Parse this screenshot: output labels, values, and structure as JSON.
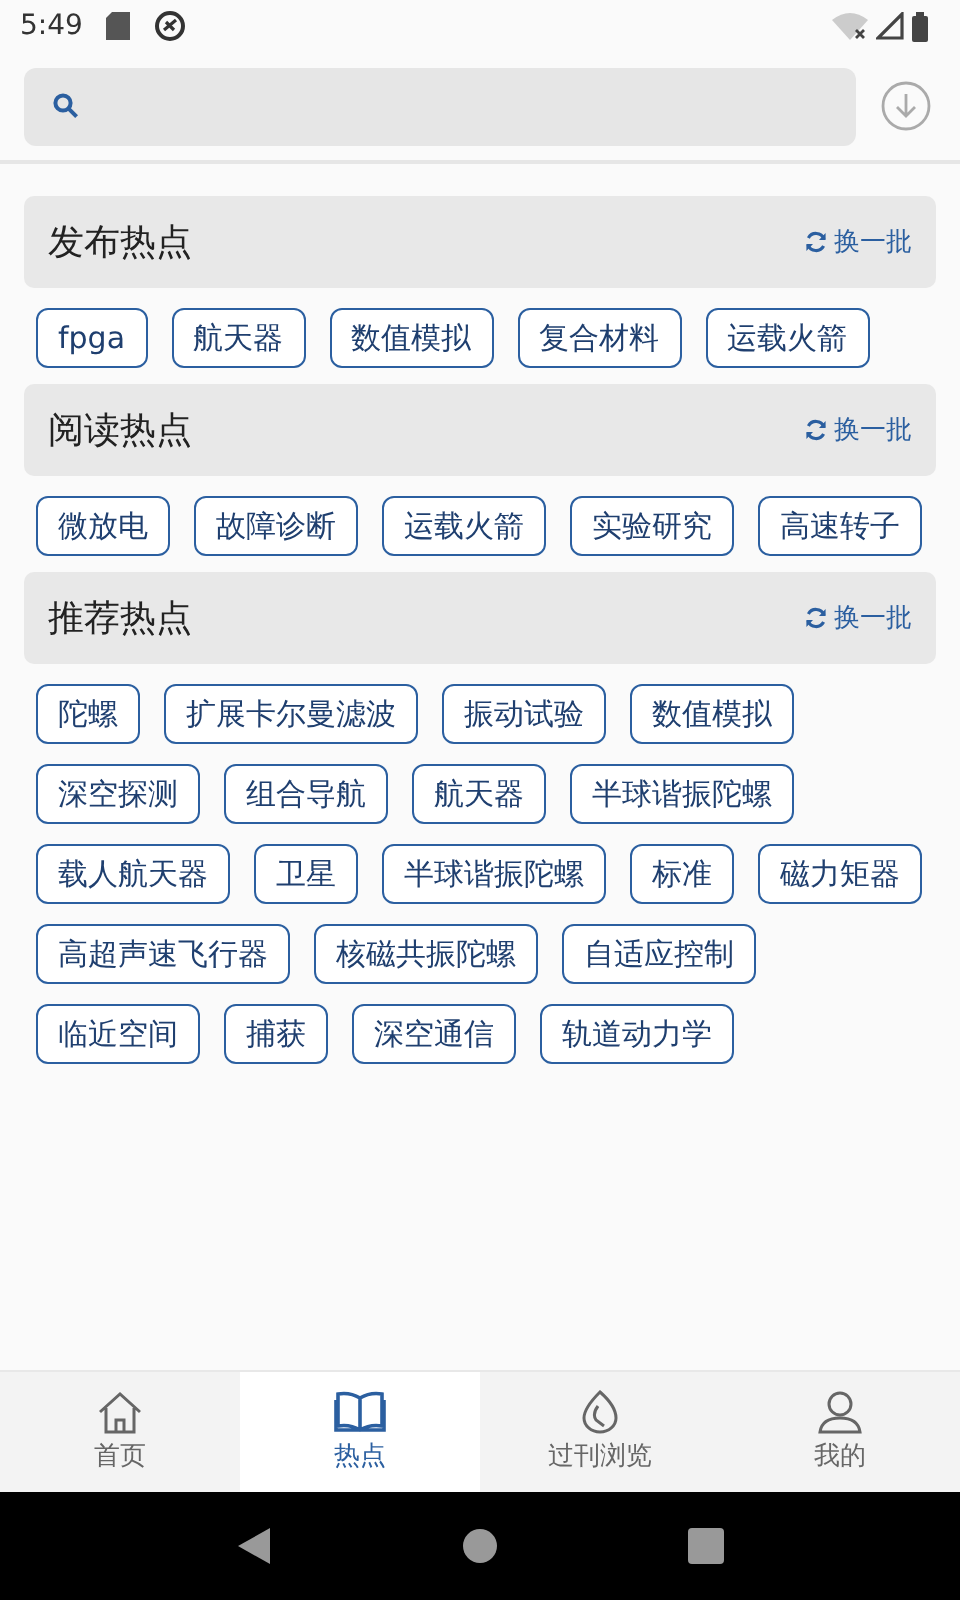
{
  "status_bar": {
    "time": "5:49"
  },
  "sections": [
    {
      "title": "发布热点",
      "refresh": "换一批",
      "tags": [
        "fpga",
        "航天器",
        "数值模拟",
        "复合材料",
        "运载火箭"
      ]
    },
    {
      "title": "阅读热点",
      "refresh": "换一批",
      "tags": [
        "微放电",
        "故障诊断",
        "运载火箭",
        "实验研究",
        "高速转子"
      ]
    },
    {
      "title": "推荐热点",
      "refresh": "换一批",
      "tags": [
        "陀螺",
        "扩展卡尔曼滤波",
        "振动试验",
        "数值模拟",
        "深空探测",
        "组合导航",
        "航天器",
        "半球谐振陀螺",
        "载人航天器",
        "卫星",
        "半球谐振陀螺",
        "标准",
        "磁力矩器",
        "高超声速飞行器",
        "核磁共振陀螺",
        "自适应控制",
        "临近空间",
        "捕获",
        "深空通信",
        "轨道动力学"
      ]
    }
  ],
  "tabs": [
    {
      "label": "首页",
      "selected": false
    },
    {
      "label": "热点",
      "selected": true
    },
    {
      "label": "过刊浏览",
      "selected": false
    },
    {
      "label": "我的",
      "selected": false
    }
  ]
}
